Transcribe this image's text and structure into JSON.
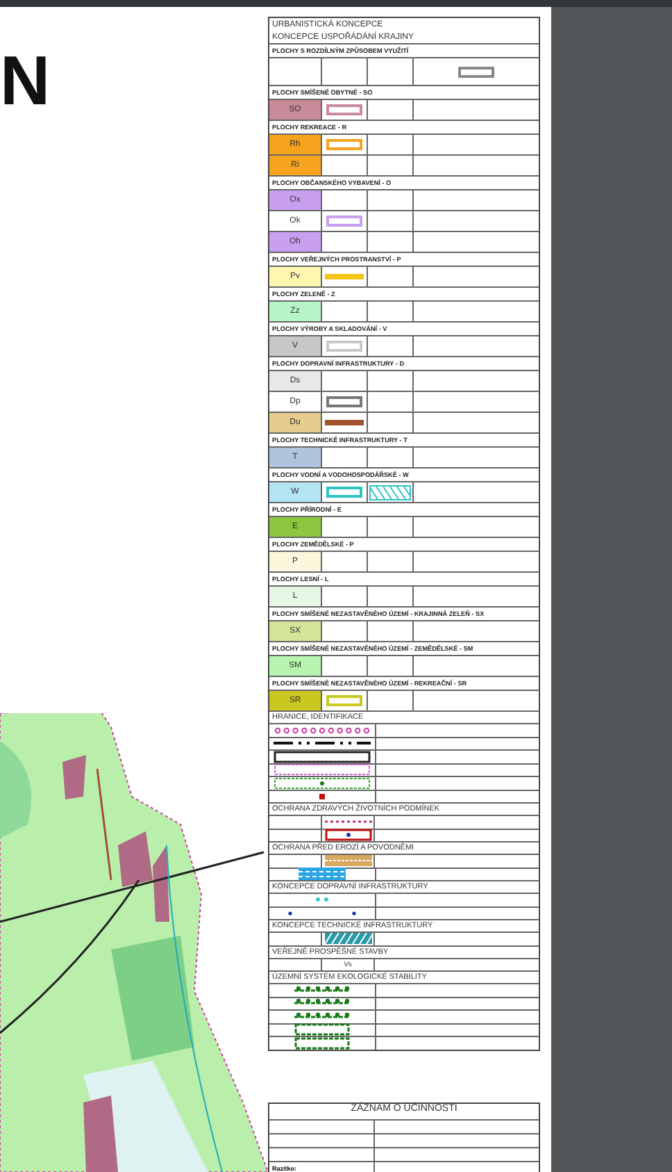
{
  "title": "N",
  "legend": {
    "title_lines": [
      "URBANISTICKÁ KONCEPCE",
      "KONCEPCE USPOŘÁDÁNÍ KRAJINY"
    ],
    "subtitle": "PLOCHY S ROZDÍLNÝM ZPŮSOBEM VYUŽITÍ",
    "groups": [
      {
        "heading": "PLOCHY SMÍŠENÉ OBYTNÉ - SO",
        "rows": [
          {
            "code": "SO",
            "color": "#c98a9a",
            "symbol": {
              "kind": "box",
              "color": "#c98a9a"
            }
          }
        ]
      },
      {
        "heading": "PLOCHY REKREACE - R",
        "rows": [
          {
            "code": "Rh",
            "color": "#f5a21d",
            "symbol": {
              "kind": "box",
              "color": "#f5a21d"
            }
          },
          {
            "code": "Ri",
            "color": "#f5a21d"
          }
        ]
      },
      {
        "heading": "PLOCHY OBČANSKÉHO VYBAVENÍ - O",
        "rows": [
          {
            "code": "Ox",
            "color": "#c9a0f0"
          },
          {
            "code": "Ok",
            "color": "#ffffff",
            "symbol": {
              "kind": "box",
              "color": "#c9a0f0"
            }
          },
          {
            "code": "Oh",
            "color": "#c9a0f0"
          }
        ]
      },
      {
        "heading": "PLOCHY VEŘEJNÝCH PROSTRANSTVÍ - P",
        "rows": [
          {
            "code": "Pv",
            "color": "#fff7b0",
            "symbol": {
              "kind": "bar",
              "color": "#f5c518"
            }
          }
        ]
      },
      {
        "heading": "PLOCHY ZELENĚ - Z",
        "rows": [
          {
            "code": "Zz",
            "color": "#b5f5c8"
          }
        ]
      },
      {
        "heading": "PLOCHY VÝROBY A SKLADOVÁNÍ - V",
        "rows": [
          {
            "code": "V",
            "color": "#c8c8c8",
            "symbol": {
              "kind": "box",
              "color": "#c8c8c8"
            }
          }
        ]
      },
      {
        "heading": "PLOCHY DOPRAVNÍ INFRASTRUKTURY - D",
        "rows": [
          {
            "code": "Ds",
            "color": "#e8e8e8"
          },
          {
            "code": "Dp",
            "color": "#ffffff",
            "symbol": {
              "kind": "box",
              "color": "#777777"
            }
          },
          {
            "code": "Du",
            "color": "#e6cc8f",
            "symbol": {
              "kind": "bar",
              "color": "#a0522d"
            }
          }
        ]
      },
      {
        "heading": "PLOCHY TECHNICKÉ INFRASTRUKTURY - T",
        "rows": [
          {
            "code": "T",
            "color": "#b0c4de"
          }
        ]
      },
      {
        "heading": "PLOCHY VODNÍ A VODOHOSPODÁŘSKÉ - W",
        "rows": [
          {
            "code": "W",
            "color": "#b3e5f5",
            "symbol": {
              "kind": "box-hatch",
              "color": "#2ec4c4"
            }
          }
        ]
      },
      {
        "heading": "PLOCHY PŘÍRODNÍ - E",
        "rows": [
          {
            "code": "E",
            "color": "#8dc63f"
          }
        ]
      },
      {
        "heading": "PLOCHY ZEMĚDĚLSKÉ - P",
        "rows": [
          {
            "code": "P",
            "color": "#fdf5dc"
          }
        ]
      },
      {
        "heading": "PLOCHY LESNÍ - L",
        "rows": [
          {
            "code": "L",
            "color": "#e6f7e6"
          }
        ]
      },
      {
        "heading": "PLOCHY SMÍŠENÉ NEZASTAVĚNÉHO ÚZEMÍ - KRAJINNÁ ZELEŇ - SX",
        "rows": [
          {
            "code": "SX",
            "color": "#d4e59a"
          }
        ]
      },
      {
        "heading": "PLOCHY SMÍŠENÉ NEZASTAVĚNÉHO ÚZEMÍ - ZEMĚDĚLSKÉ - SM",
        "rows": [
          {
            "code": "SM",
            "color": "#b5f5b0"
          }
        ]
      },
      {
        "heading": "PLOCHY SMÍŠENÉ NEZASTAVĚNÉHO ÚZEMÍ - REKREAČNÍ - SR",
        "rows": [
          {
            "code": "SR",
            "color": "#c8c820",
            "symbol": {
              "kind": "box",
              "color": "#c8c820"
            }
          }
        ]
      }
    ],
    "sections": [
      {
        "heading": "HRANICE, IDENTIFIKACE",
        "rows": [
          {
            "kind": "dots"
          },
          {
            "kind": "dashdot"
          },
          {
            "kind": "frame"
          },
          {
            "kind": "pinkdash"
          },
          {
            "kind": "greendash"
          },
          {
            "kind": "reddot"
          }
        ]
      },
      {
        "heading": "OCHRANA ZDRAVÝCH ŽIVOTNÍCH PODMÍNEK",
        "rows": [
          {
            "kind": "pinkline"
          },
          {
            "kind": "redframe"
          }
        ]
      },
      {
        "heading": "OCHRANA PŘED EROZÍ A POVODNĚMI",
        "rows": [
          {
            "kind": "tanhatch"
          },
          {
            "kind": "waves"
          }
        ]
      },
      {
        "heading": "KONCEPCE DOPRAVNÍ INFRASTRUKTURY",
        "rows": [
          {
            "kind": "cyandots"
          },
          {
            "kind": "bluedots"
          }
        ]
      },
      {
        "heading": "KONCEPCE TECHNICKÉ INFRASTRUKTURY",
        "rows": [
          {
            "kind": "tealhatch"
          }
        ]
      },
      {
        "heading": "VEŘEJNĚ PROSPĚŠNÉ STAVBY",
        "rows": [
          {
            "kind": "text",
            "text": "Vs"
          }
        ]
      },
      {
        "heading": "ÚZEMNÍ SYSTÉM EKOLOGICKÉ STABILITY",
        "rows": [
          {
            "kind": "fringe"
          },
          {
            "kind": "fringe"
          },
          {
            "kind": "fringe"
          },
          {
            "kind": "greenframe"
          },
          {
            "kind": "greenframe"
          }
        ]
      }
    ]
  },
  "record": {
    "title": "ZÁZNAM O ÚČINNOSTI",
    "stamp_label": "Razítko:"
  }
}
